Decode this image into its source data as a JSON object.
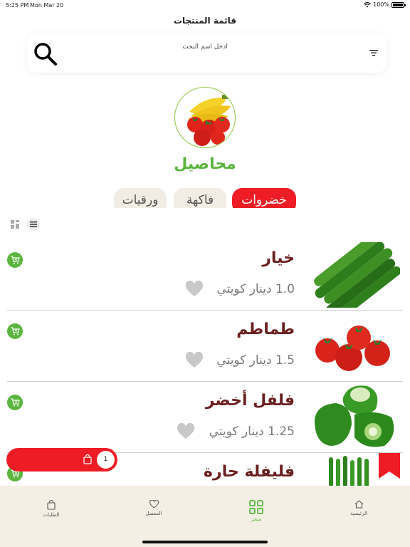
{
  "status_bar": {
    "time": "5:25 PM",
    "date": "Mon Mar 20",
    "battery": "100%"
  },
  "header": {
    "title": "قائمة المنتجات"
  },
  "search": {
    "placeholder": "ادخل اسم البحث"
  },
  "category": {
    "title": "محاصيل"
  },
  "chips": [
    {
      "label": "خضروات",
      "active": true
    },
    {
      "label": "فاكهة",
      "active": false
    },
    {
      "label": "ورقيات",
      "active": false
    }
  ],
  "products": [
    {
      "name": "خيار",
      "price": "1.0 دينار كويتي",
      "image": "cucumber"
    },
    {
      "name": "طماطم",
      "price": "1.5 دينار كويتي",
      "image": "tomato"
    },
    {
      "name": "فلفل أخضر",
      "price": "1.25 دينار كويتي",
      "image": "green-pepper"
    },
    {
      "name": "فليفلة حارة",
      "price": "",
      "image": "chili"
    }
  ],
  "cart": {
    "count": "1"
  },
  "bottom_nav": [
    {
      "label": "الطلبات",
      "icon": "bag-icon",
      "active": false
    },
    {
      "label": "المفضل",
      "icon": "heart-icon",
      "active": false
    },
    {
      "label": "متجر",
      "icon": "grid-icon",
      "active": true
    },
    {
      "label": "الرئيسية",
      "icon": "home-icon",
      "active": false
    }
  ],
  "colors": {
    "accent_red": "#ee1c25",
    "accent_green": "#5bb53f",
    "product_name": "#6b1f1f",
    "nav_bg": "#f4efe4"
  }
}
